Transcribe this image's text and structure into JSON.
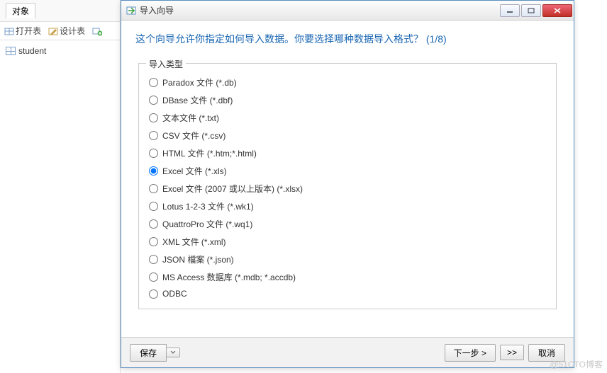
{
  "sidebar": {
    "tab_label": "对象",
    "toolbar": {
      "open_table": "打开表",
      "design_table": "设计表"
    },
    "items": [
      {
        "label": "student"
      }
    ]
  },
  "dialog": {
    "title": "导入向导",
    "heading": "这个向导允许你指定如何导入数据。你要选择哪种数据导入格式？ (1/8)",
    "group_label": "导入类型",
    "options": [
      {
        "label": "Paradox 文件 (*.db)",
        "selected": false
      },
      {
        "label": "DBase 文件 (*.dbf)",
        "selected": false
      },
      {
        "label": "文本文件 (*.txt)",
        "selected": false
      },
      {
        "label": "CSV 文件 (*.csv)",
        "selected": false
      },
      {
        "label": "HTML 文件 (*.htm;*.html)",
        "selected": false
      },
      {
        "label": "Excel 文件 (*.xls)",
        "selected": true
      },
      {
        "label": "Excel 文件 (2007 或以上版本) (*.xlsx)",
        "selected": false
      },
      {
        "label": "Lotus 1-2-3 文件 (*.wk1)",
        "selected": false
      },
      {
        "label": "QuattroPro 文件 (*.wq1)",
        "selected": false
      },
      {
        "label": "XML 文件 (*.xml)",
        "selected": false
      },
      {
        "label": "JSON 檔案 (*.json)",
        "selected": false
      },
      {
        "label": "MS Access 数据库 (*.mdb; *.accdb)",
        "selected": false
      },
      {
        "label": "ODBC",
        "selected": false
      }
    ],
    "buttons": {
      "save": "保存",
      "next": "下一步 >",
      "jump": ">>",
      "cancel": "取消"
    }
  },
  "watermark": "@51CTO博客"
}
